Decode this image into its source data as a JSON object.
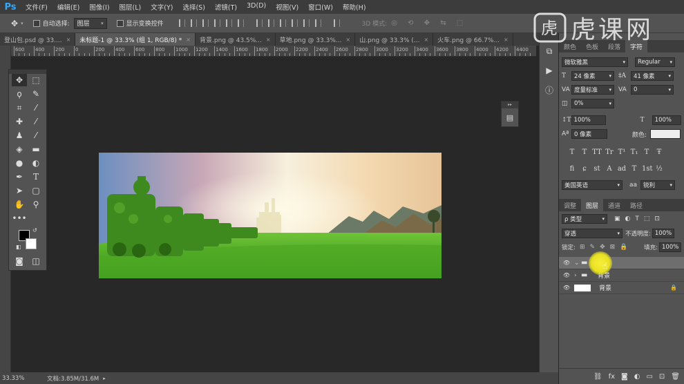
{
  "app": {
    "logo": "Ps"
  },
  "menu": [
    "文件(F)",
    "编辑(E)",
    "图像(I)",
    "图层(L)",
    "文字(Y)",
    "选择(S)",
    "滤镜(T)",
    "3D(D)",
    "视图(V)",
    "窗口(W)",
    "帮助(H)"
  ],
  "options": {
    "auto_select_label": "自动选择:",
    "auto_select_value": "图层",
    "show_transform_label": "显示变换控件",
    "mode_label": "3D 模式:"
  },
  "tabs": [
    {
      "label": "登山包.psd @ 33....",
      "active": false
    },
    {
      "label": "未标题-1 @ 33.3% (组 1, RGB/8) *",
      "active": true
    },
    {
      "label": "背景.png @ 43.5%...",
      "active": false
    },
    {
      "label": "草地.png @ 33.3%...",
      "active": false
    },
    {
      "label": "山.png @ 33.3% (...",
      "active": false
    },
    {
      "label": "火车.png @ 66.7%...",
      "active": false
    }
  ],
  "ruler_h": [
    "600",
    "400",
    "200",
    "0",
    "200",
    "400",
    "600",
    "800",
    "1000",
    "1200",
    "1400",
    "1600",
    "1800",
    "2000",
    "2200",
    "2400",
    "2600",
    "2800",
    "3000",
    "3200",
    "3400",
    "3600",
    "3800",
    "4000",
    "4200",
    "4400"
  ],
  "character_panel": {
    "tabs": [
      "颜色",
      "色板",
      "段落",
      "字符"
    ],
    "font_family": "微软雅黑",
    "font_style": "Regular",
    "font_size": "24 像素",
    "leading": "41 像素",
    "kerning": "度量标准",
    "tracking": "0",
    "scale_pct": "0%",
    "vscale": "100%",
    "hscale": "100%",
    "baseline": "0 像素",
    "color_label": "颜色:",
    "color_swatch": "#eeeeee",
    "language": "美国英语",
    "aa_label": "aa",
    "aa_value": "锐利",
    "style_buttons": [
      "T",
      "T",
      "TT",
      "Tr",
      "T¹",
      "T₁",
      "T",
      "Ŧ"
    ],
    "opentype_buttons": [
      "fi",
      "ɕ",
      "st",
      "A",
      "ad",
      "T",
      "1st",
      "½"
    ]
  },
  "layers_panel": {
    "tabs": [
      "调整",
      "图层",
      "通道",
      "路径"
    ],
    "filter_label": "ρ 类型",
    "blend_mode": "穿透",
    "opacity_label": "不透明度:",
    "opacity": "100%",
    "lock_label": "锁定:",
    "fill_label": "填充:",
    "fill": "100%",
    "layers": [
      {
        "name": "组 1",
        "type": "group",
        "open": true,
        "selected": true
      },
      {
        "name": "背景",
        "type": "group",
        "open": false,
        "selected": false
      },
      {
        "name": "背景",
        "type": "layer",
        "open": false,
        "selected": false,
        "locked": true
      }
    ],
    "bottom_icons": [
      "link-icon",
      "fx-icon",
      "mask-icon",
      "adjust-icon",
      "folder-icon",
      "new-layer-icon",
      "trash-icon"
    ]
  },
  "status": {
    "zoom": "33.33%",
    "doc": "文档:3.85M/31.6M"
  },
  "watermark": "虎课网",
  "colors": {
    "fg": "#000000",
    "bg": "#ffffff",
    "accent": "#31a8ff"
  }
}
